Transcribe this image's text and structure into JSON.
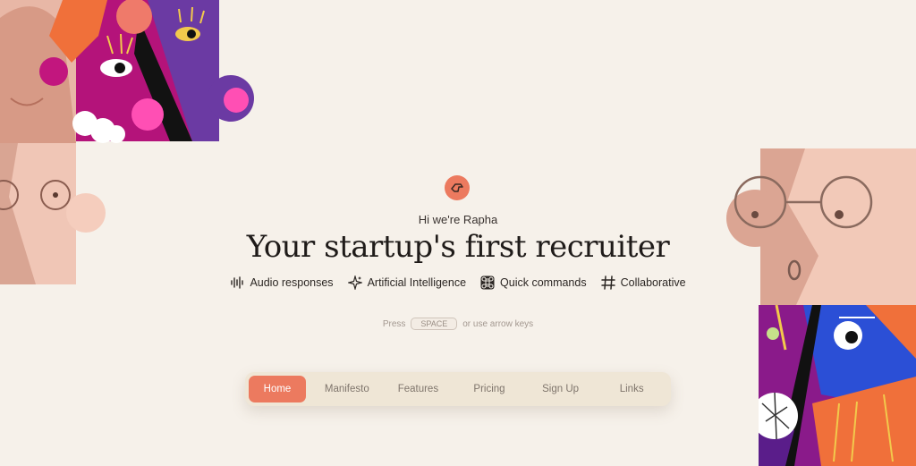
{
  "hero": {
    "greeting": "Hi we're Rapha",
    "headline": "Your startup's first recruiter"
  },
  "features": [
    {
      "icon": "audio-wave-icon",
      "label": "Audio responses"
    },
    {
      "icon": "sparkles-icon",
      "label": "Artificial Intelligence"
    },
    {
      "icon": "command-icon",
      "label": "Quick commands"
    },
    {
      "icon": "hash-icon",
      "label": "Collaborative"
    }
  ],
  "hint": {
    "prefix": "Press",
    "key": "SPACE",
    "suffix": "or use arrow keys"
  },
  "nav": {
    "items": [
      "Home",
      "Manifesto",
      "Features",
      "Pricing",
      "Sign Up",
      "Links"
    ],
    "active": "Home"
  },
  "colors": {
    "background": "#f6f1ea",
    "accent": "#ec7a5f",
    "nav_bg": "#efe6d6"
  }
}
